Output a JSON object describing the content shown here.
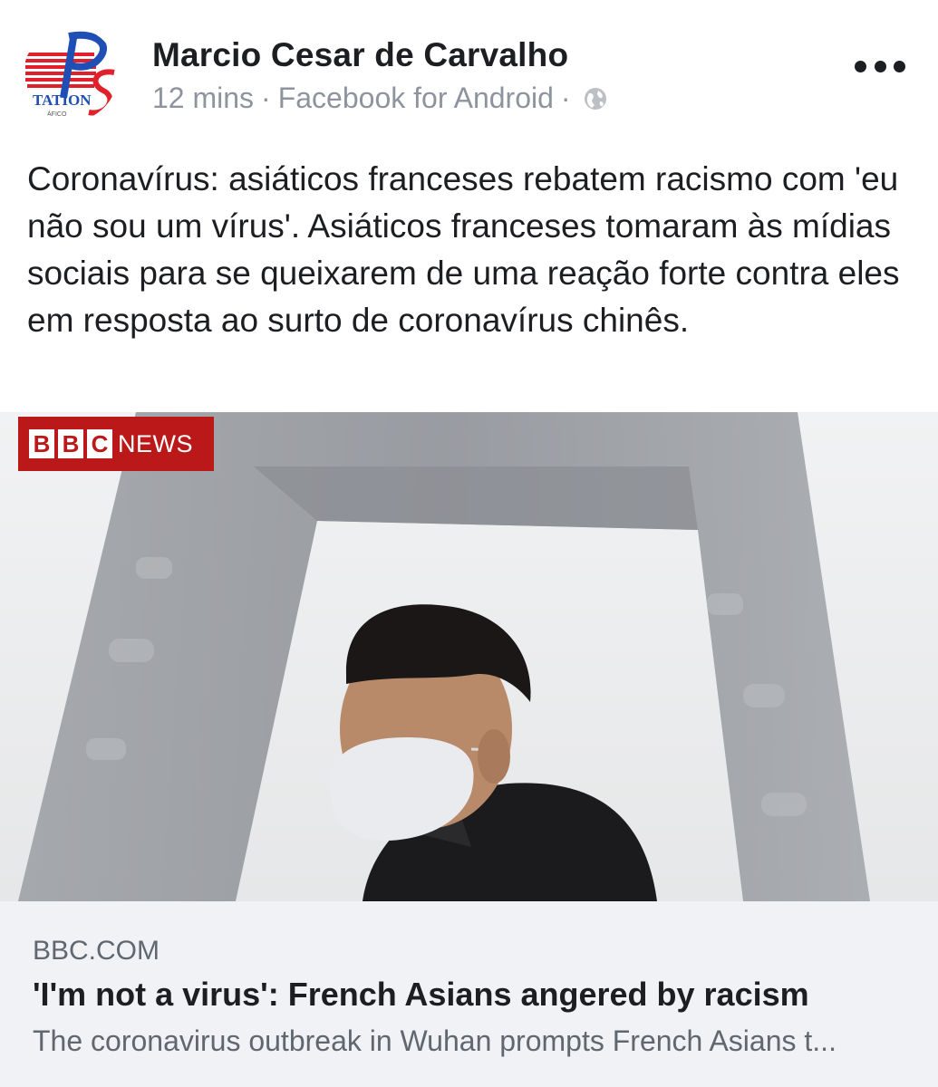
{
  "post": {
    "author": "Marcio Cesar de Carvalho",
    "time": "12 mins",
    "separator": "·",
    "source": "Facebook for Android",
    "privacy_icon": "globe-icon",
    "avatar_logo_text": "TATION",
    "avatar_sub_text": "ÁFICO",
    "text": "Coronavírus: asiáticos franceses rebatem racismo com 'eu não sou um vírus'. Asiáticos franceses tomaram às mídias sociais para se queixarem de uma reação forte contra eles em resposta ao surto de coronavírus chinês."
  },
  "link": {
    "badge": {
      "letters": [
        "B",
        "B",
        "C"
      ],
      "word": "NEWS"
    },
    "domain": "BBC.COM",
    "title": "'I'm not a virus': French Asians angered by racism",
    "description": "The coronavirus outbreak in Wuhan prompts French Asians t..."
  },
  "colors": {
    "text_primary": "#1c1e21",
    "text_secondary": "#8d949e",
    "preview_bg": "#f0f2f5",
    "bbc_red": "#bb1919",
    "avatar_blue": "#1f4fb5",
    "avatar_red": "#e0202a"
  }
}
